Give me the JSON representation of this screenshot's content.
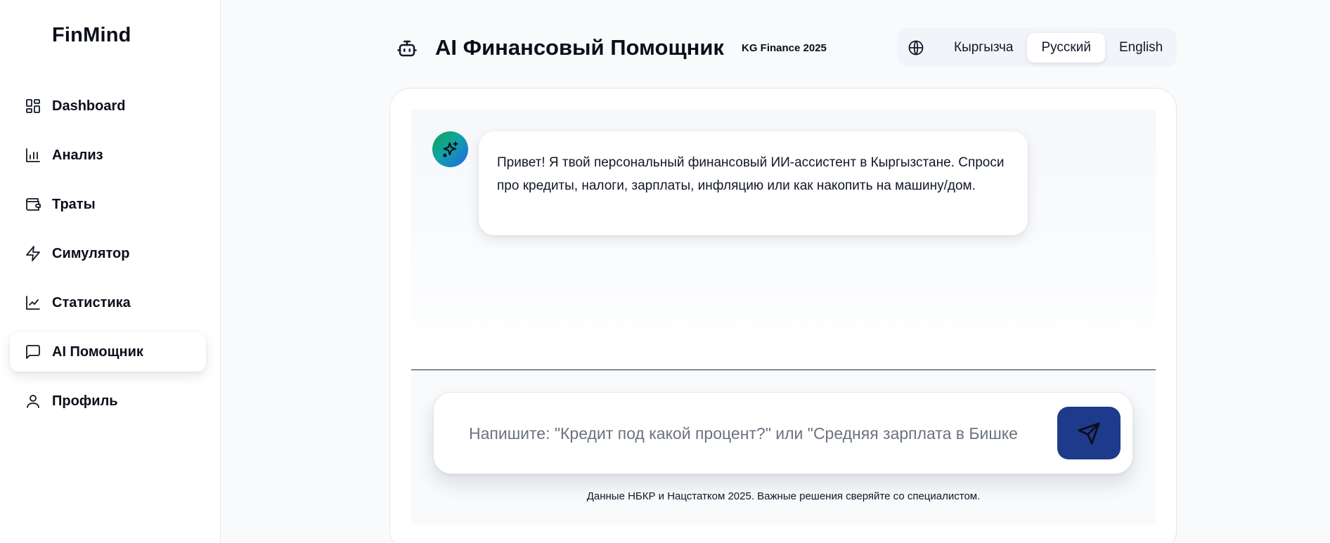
{
  "brand": {
    "name": "FinMind"
  },
  "sidebar": {
    "items": [
      {
        "label": "Dashboard",
        "icon": "grid-icon"
      },
      {
        "label": "Анализ",
        "icon": "bar-chart-icon"
      },
      {
        "label": "Траты",
        "icon": "wallet-icon"
      },
      {
        "label": "Симулятор",
        "icon": "lightning-icon"
      },
      {
        "label": "Статистика",
        "icon": "line-chart-icon"
      },
      {
        "label": "AI Помощник",
        "icon": "chat-icon",
        "active": true
      },
      {
        "label": "Профиль",
        "icon": "user-icon"
      }
    ]
  },
  "header": {
    "icon": "robot-icon",
    "title": "AI Финансовый Помощник",
    "badge": "KG Finance 2025"
  },
  "language": {
    "icon": "globe-icon",
    "options": [
      {
        "label": "Кыргызча"
      },
      {
        "label": "Русский",
        "active": true
      },
      {
        "label": "English"
      }
    ]
  },
  "chat": {
    "assistant_avatar_icon": "sparkles-icon",
    "messages": [
      {
        "role": "assistant",
        "text": "Привет! Я твой персональный финансовый ИИ-ассистент в Кыргызстане. Спроси про кредиты, налоги, зарплаты, инфляцию или как накопить на машину/дом."
      }
    ],
    "input_placeholder": "Напишите: \"Кредит под какой процент?\" или \"Средняя зарплата в Бишкеке?\"",
    "input_value": "",
    "send_icon": "send-icon",
    "disclaimer": "Данные НБКР и Нацстатком 2025. Важные решения сверяйте со специалистом."
  },
  "colors": {
    "accent": "#1e3a8a",
    "background": "#f8fafc",
    "avatar_gradient_start": "#16a34a",
    "avatar_gradient_end": "#2563eb"
  }
}
